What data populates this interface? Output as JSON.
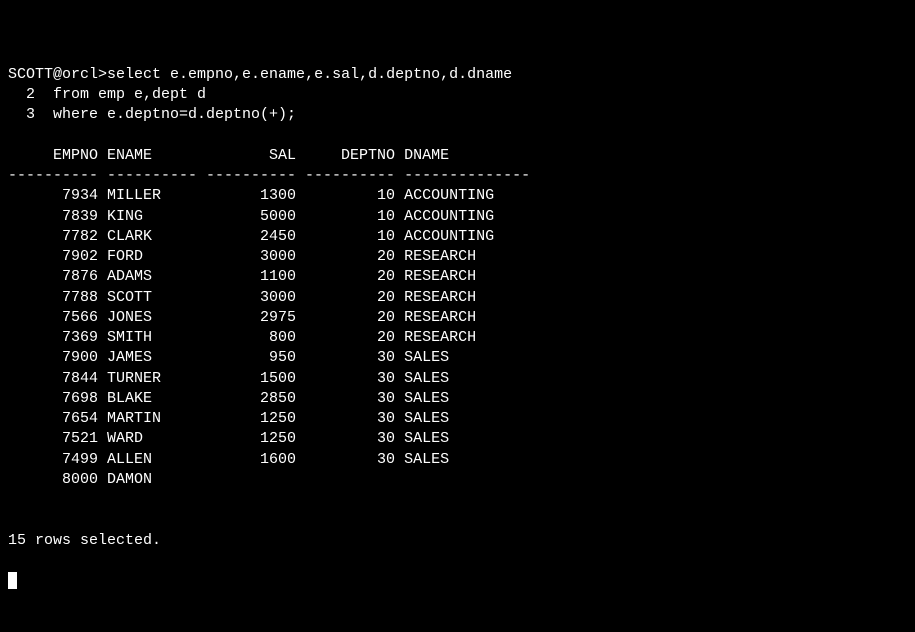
{
  "prompt": "SCOTT@orcl>",
  "sql_lines": [
    "select e.empno,e.ename,e.sal,d.deptno,d.dname",
    "from emp e,dept d",
    "where e.deptno=d.deptno(+);"
  ],
  "line_num_2": "  2  ",
  "line_num_3": "  3  ",
  "blank": "",
  "header": "     EMPNO ENAME             SAL     DEPTNO DNAME",
  "separator": "---------- ---------- ---------- ---------- --------------",
  "chart_data": {
    "type": "table",
    "columns": [
      "EMPNO",
      "ENAME",
      "SAL",
      "DEPTNO",
      "DNAME"
    ],
    "rows": [
      {
        "EMPNO": 7934,
        "ENAME": "MILLER",
        "SAL": 1300,
        "DEPTNO": 10,
        "DNAME": "ACCOUNTING"
      },
      {
        "EMPNO": 7839,
        "ENAME": "KING",
        "SAL": 5000,
        "DEPTNO": 10,
        "DNAME": "ACCOUNTING"
      },
      {
        "EMPNO": 7782,
        "ENAME": "CLARK",
        "SAL": 2450,
        "DEPTNO": 10,
        "DNAME": "ACCOUNTING"
      },
      {
        "EMPNO": 7902,
        "ENAME": "FORD",
        "SAL": 3000,
        "DEPTNO": 20,
        "DNAME": "RESEARCH"
      },
      {
        "EMPNO": 7876,
        "ENAME": "ADAMS",
        "SAL": 1100,
        "DEPTNO": 20,
        "DNAME": "RESEARCH"
      },
      {
        "EMPNO": 7788,
        "ENAME": "SCOTT",
        "SAL": 3000,
        "DEPTNO": 20,
        "DNAME": "RESEARCH"
      },
      {
        "EMPNO": 7566,
        "ENAME": "JONES",
        "SAL": 2975,
        "DEPTNO": 20,
        "DNAME": "RESEARCH"
      },
      {
        "EMPNO": 7369,
        "ENAME": "SMITH",
        "SAL": 800,
        "DEPTNO": 20,
        "DNAME": "RESEARCH"
      },
      {
        "EMPNO": 7900,
        "ENAME": "JAMES",
        "SAL": 950,
        "DEPTNO": 30,
        "DNAME": "SALES"
      },
      {
        "EMPNO": 7844,
        "ENAME": "TURNER",
        "SAL": 1500,
        "DEPTNO": 30,
        "DNAME": "SALES"
      },
      {
        "EMPNO": 7698,
        "ENAME": "BLAKE",
        "SAL": 2850,
        "DEPTNO": 30,
        "DNAME": "SALES"
      },
      {
        "EMPNO": 7654,
        "ENAME": "MARTIN",
        "SAL": 1250,
        "DEPTNO": 30,
        "DNAME": "SALES"
      },
      {
        "EMPNO": 7521,
        "ENAME": "WARD",
        "SAL": 1250,
        "DEPTNO": 30,
        "DNAME": "SALES"
      },
      {
        "EMPNO": 7499,
        "ENAME": "ALLEN",
        "SAL": 1600,
        "DEPTNO": 30,
        "DNAME": "SALES"
      },
      {
        "EMPNO": 8000,
        "ENAME": "DAMON",
        "SAL": null,
        "DEPTNO": null,
        "DNAME": null
      }
    ]
  },
  "footer": "15 rows selected."
}
